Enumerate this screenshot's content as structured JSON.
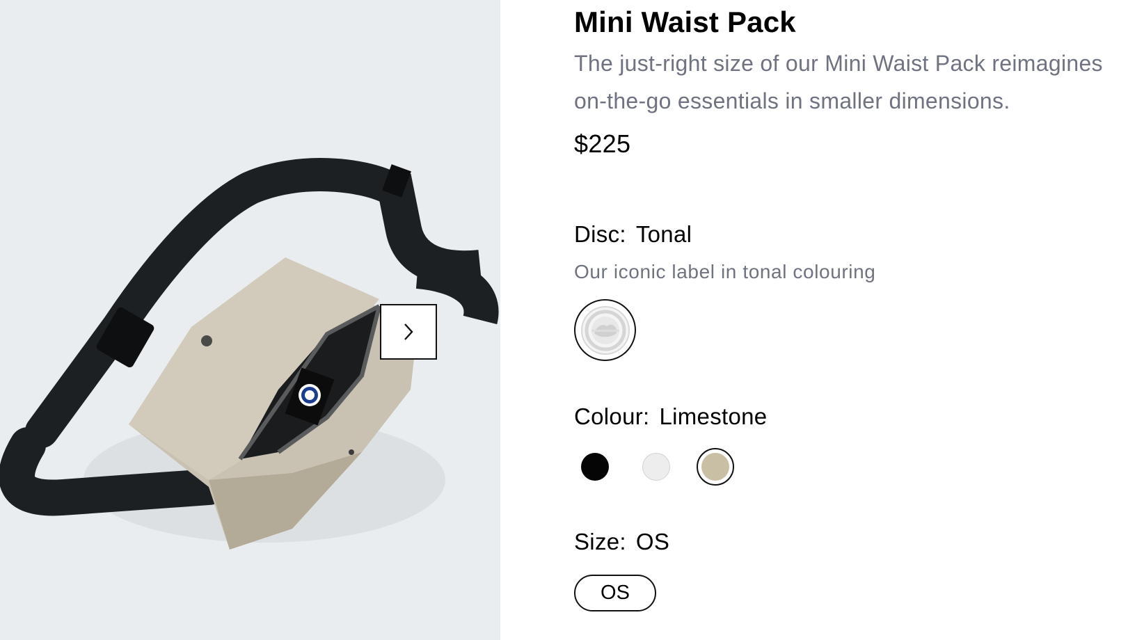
{
  "product": {
    "title": "Mini Waist Pack",
    "description": "The just-right size of our Mini Waist Pack reimagines on-the-go essentials in smaller dimensions.",
    "price": "$225"
  },
  "gallery": {
    "image_alt": "Mini Waist Pack product photo",
    "next_icon": "chevron-right-icon"
  },
  "disc": {
    "label": "Disc:",
    "value": "Tonal",
    "note": "Our iconic label in tonal colouring",
    "swatch_icon": "disc-badge-icon"
  },
  "colour": {
    "label": "Colour:",
    "value": "Limestone",
    "options": [
      {
        "name": "Black",
        "color": "#050505"
      },
      {
        "name": "White",
        "color": "#ededed"
      },
      {
        "name": "Limestone",
        "color": "#c9bfa4",
        "selected": true
      }
    ]
  },
  "size": {
    "label": "Size:",
    "value": "OS",
    "options": [
      "OS"
    ]
  }
}
